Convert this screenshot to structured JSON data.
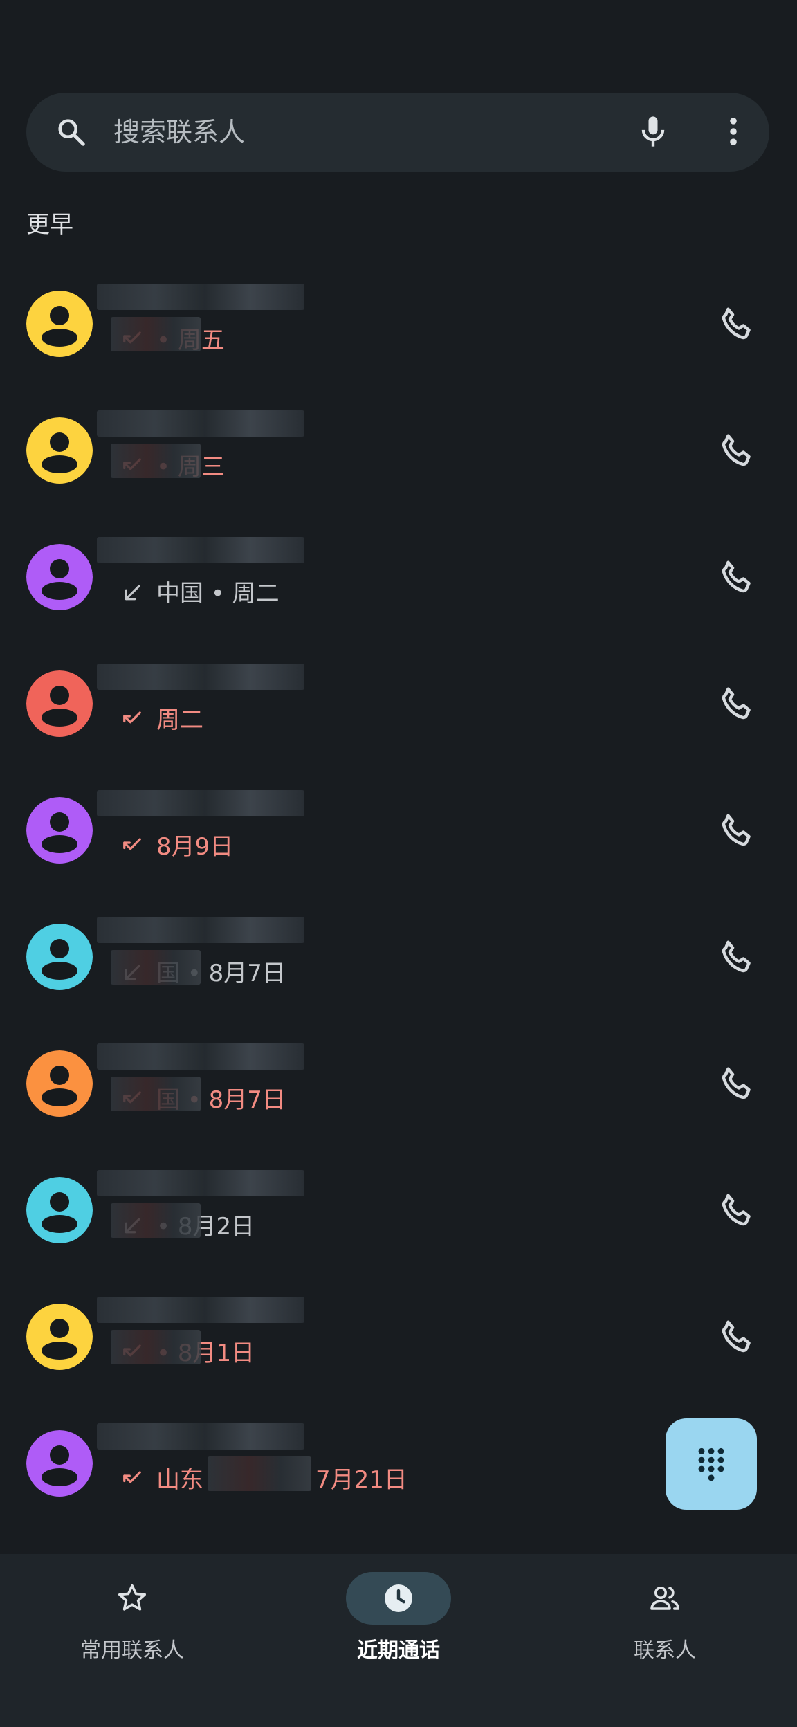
{
  "search": {
    "placeholder": "搜索联系人",
    "search_icon": "search-icon",
    "mic_icon": "mic-icon",
    "more_icon": "more-vert-icon"
  },
  "section": {
    "title": "更早"
  },
  "colors": {
    "missed": "#f28b82",
    "normal": "#c4c7cb",
    "fab": "#9ad6f0",
    "nav_active_pill": "#344a55"
  },
  "calls": [
    {
      "avatar_color": "#fdd33f",
      "direction": "missed",
      "detail": "• 周五",
      "phone_icon": "phone-icon"
    },
    {
      "avatar_color": "#fdd33f",
      "direction": "missed",
      "detail": "• 周三",
      "phone_icon": "phone-icon"
    },
    {
      "avatar_color": "#af5cf7",
      "direction": "incoming",
      "detail": "中国 • 周二",
      "phone_icon": "phone-icon"
    },
    {
      "avatar_color": "#f0645a",
      "direction": "missed",
      "detail": "周二",
      "phone_icon": "phone-icon"
    },
    {
      "avatar_color": "#af5cf7",
      "direction": "missed",
      "detail": "8月9日",
      "phone_icon": "phone-icon"
    },
    {
      "avatar_color": "#4fcfe3",
      "direction": "incoming",
      "detail": "国 • 8月7日",
      "phone_icon": "phone-icon"
    },
    {
      "avatar_color": "#fb9140",
      "direction": "missed",
      "detail": "国 • 8月7日",
      "phone_icon": "phone-icon"
    },
    {
      "avatar_color": "#4fcfe3",
      "direction": "incoming",
      "detail": "• 8月2日",
      "phone_icon": "phone-icon"
    },
    {
      "avatar_color": "#fdd33f",
      "direction": "missed",
      "detail": "• 8月1日",
      "phone_icon": "phone-icon"
    },
    {
      "avatar_color": "#af5cf7",
      "direction": "missed",
      "detail": "山东",
      "detail2": "7月21日",
      "phone_icon": "phone-icon"
    }
  ],
  "fab": {
    "icon": "dialpad-icon"
  },
  "nav": {
    "favorites": {
      "label": "常用联系人",
      "icon": "star-icon"
    },
    "recents": {
      "label": "近期通话",
      "icon": "clock-icon",
      "active": true
    },
    "contacts": {
      "label": "联系人",
      "icon": "people-icon"
    }
  }
}
